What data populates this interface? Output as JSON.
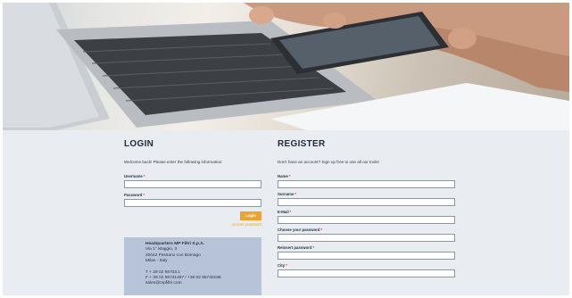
{
  "login": {
    "title": "LOGIN",
    "intro": "Welcome back! Please enter the following information:",
    "username_label": "Username",
    "password_label": "Password",
    "required_mark": "*",
    "button_label": "Login",
    "recover_link": "recover password"
  },
  "register": {
    "title": "REGISTER",
    "intro": "Don't have an account? Sign up free to use all our tools!",
    "fields": [
      {
        "label": "Name"
      },
      {
        "label": "Surname"
      },
      {
        "label": "E-Mail"
      },
      {
        "label": "Choose your password"
      },
      {
        "label": "Reinsert password"
      },
      {
        "label": "City"
      }
    ]
  },
  "headquarters": {
    "title": "Headquarters MP Filtri S.p.A.",
    "address_line1": "Via 1° Maggio, 3",
    "address_line2": "20042 Pessano con Bornago",
    "address_line3": "Milan - Italy",
    "phone": "T   + 39 02 95703.1",
    "fax": "F   + 39 02 95741497 / +39 02 95740188",
    "email": "sales@mpfiltri.com"
  },
  "colors": {
    "accent": "#f0a22e",
    "page_background": "#e9edf2",
    "info_box": "#b7c3d8",
    "heading": "#1f2a3a"
  }
}
